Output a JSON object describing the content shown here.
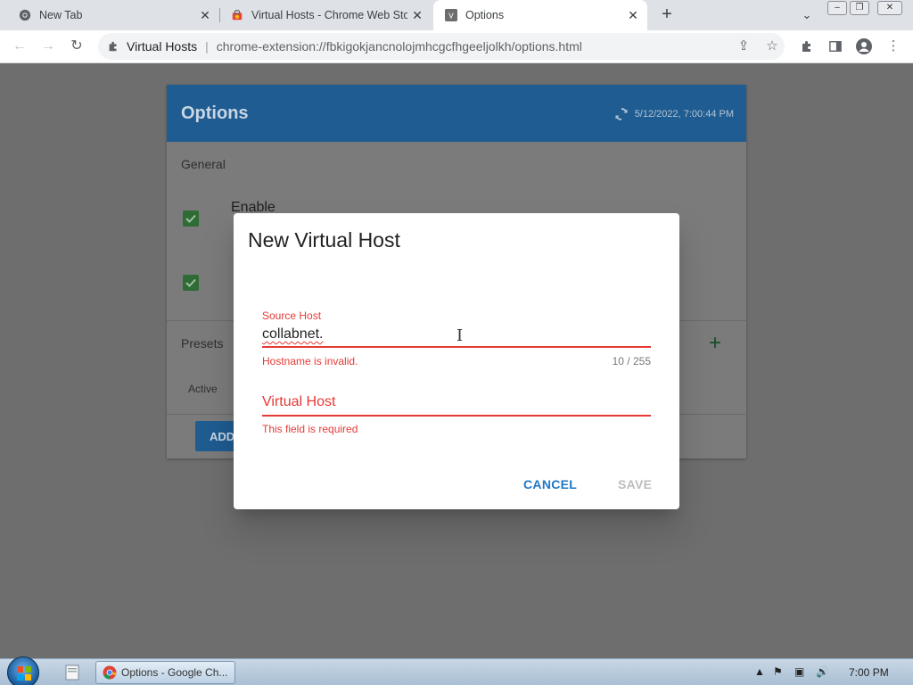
{
  "browser": {
    "tabs": [
      {
        "title": "New Tab",
        "favicon": "chrome-icon"
      },
      {
        "title": "Virtual Hosts - Chrome Web Stor",
        "favicon": "webstore-icon"
      },
      {
        "title": "Options",
        "favicon": "extension-v-icon"
      }
    ],
    "omnibox": {
      "site_name": "Virtual Hosts",
      "separator": "|",
      "url": "chrome-extension://fbkigokjancnolojmhcgcfhgeeljolkh/options.html"
    }
  },
  "page": {
    "title": "Options",
    "sync_timestamp": "5/12/2022, 7:00:44 PM",
    "general_label": "General",
    "option1_text": "Enable",
    "presets_label": "Presets",
    "active_header": "Active",
    "add_button_label": "ADD"
  },
  "dialog": {
    "title": "New Virtual Host",
    "source_host": {
      "label": "Source Host",
      "value": "collabnet.",
      "error": "Hostname is invalid.",
      "counter": "10 / 255"
    },
    "virtual_host": {
      "label": "Virtual Host",
      "error": "This field is required"
    },
    "cancel_label": "CANCEL",
    "save_label": "SAVE"
  },
  "taskbar": {
    "task_label": "Options - Google Ch...",
    "clock": "7:00 PM"
  },
  "colors": {
    "accent": "#1f77c6",
    "error": "#e53935",
    "checkbox": "#388e3c"
  }
}
